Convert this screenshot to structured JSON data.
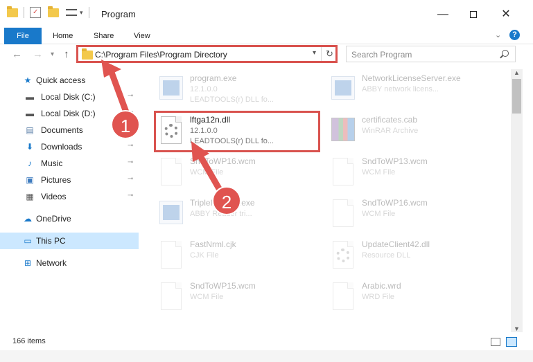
{
  "window": {
    "title": "Program",
    "min_glyph": "—",
    "close_glyph": "✕"
  },
  "ribbon": {
    "file": "File",
    "home": "Home",
    "share": "Share",
    "view": "View"
  },
  "nav": {
    "back": "←",
    "forward": "→",
    "recent": "▾",
    "up": "↑",
    "address": "C:\\Program Files\\Program Directory",
    "address_drop": "▾",
    "refresh": "↻",
    "search_placeholder": "Search Program"
  },
  "sidebar": {
    "items": [
      {
        "label": "Quick access",
        "icon": "star-icon",
        "glyph": "★",
        "color": "#1979ca",
        "pinned": false
      },
      {
        "label": "Local Disk (C:)",
        "icon": "drive-icon",
        "glyph": "▬",
        "color": "#555555",
        "pinned": true
      },
      {
        "label": "Local Disk (D:)",
        "icon": "drive-icon",
        "glyph": "▬",
        "color": "#555555",
        "pinned": true
      },
      {
        "label": "Documents",
        "icon": "documents-icon",
        "glyph": "▤",
        "color": "#5b7fa8",
        "pinned": true
      },
      {
        "label": "Downloads",
        "icon": "download-icon",
        "glyph": "⬇",
        "color": "#1979ca",
        "pinned": true
      },
      {
        "label": "Music",
        "icon": "music-icon",
        "glyph": "♪",
        "color": "#1979ca",
        "pinned": true
      },
      {
        "label": "Pictures",
        "icon": "pictures-icon",
        "glyph": "▣",
        "color": "#3e7bbf",
        "pinned": true
      },
      {
        "label": "Videos",
        "icon": "videos-icon",
        "glyph": "▦",
        "color": "#555555",
        "pinned": true
      },
      {
        "label": "OneDrive",
        "icon": "cloud-icon",
        "glyph": "☁",
        "color": "#1979ca",
        "pinned": false
      },
      {
        "label": "This PC",
        "icon": "monitor-icon",
        "glyph": "▭",
        "color": "#1979ca",
        "pinned": false,
        "selected": true
      },
      {
        "label": "Network",
        "icon": "network-icon",
        "glyph": "⊞",
        "color": "#1979ca",
        "pinned": false
      }
    ],
    "pin_glyph": "📌"
  },
  "files": [
    {
      "name": "program.exe",
      "line1": "12.1.0.0",
      "line2": "LEADTOOLS(r) DLL fo...",
      "icon": "exe-icon",
      "faded": true
    },
    {
      "name": "NetworkLicenseServer.exe",
      "line1": "ABBY network licens...",
      "line2": "",
      "icon": "exe-icon",
      "faded": true
    },
    {
      "name": "lftga12n.dll",
      "line1": "12.1.0.0",
      "line2": "LEADTOOLS(r) DLL fo...",
      "icon": "gear-icon",
      "faded": false
    },
    {
      "name": "certificates.cab",
      "line1": "WinRAR Archive",
      "line2": "",
      "icon": "archive-icon",
      "faded": true
    },
    {
      "name": "SndToWP16.wcm",
      "line1": "WCM File",
      "line2": "",
      "icon": "document-icon",
      "faded": true
    },
    {
      "name": "SndToWP13.wcm",
      "line1": "WCM File",
      "line2": "",
      "icon": "document-icon",
      "faded": true
    },
    {
      "name": "TripleInstaller.exe",
      "line1": "ABBY Reader tri...",
      "line2": "",
      "icon": "exe-icon",
      "faded": true
    },
    {
      "name": "SndToWP16.wcm",
      "line1": "WCM File",
      "line2": "",
      "icon": "document-icon",
      "faded": true
    },
    {
      "name": "FastNrml.cjk",
      "line1": "CJK File",
      "line2": "",
      "icon": "document-icon",
      "faded": true
    },
    {
      "name": "UpdateClient42.dll",
      "line1": "Resource DLL",
      "line2": "",
      "icon": "gear-icon",
      "faded": true
    },
    {
      "name": "SndToWP15.wcm",
      "line1": "WCM File",
      "line2": "",
      "icon": "document-icon",
      "faded": true
    },
    {
      "name": "Arabic.wrd",
      "line1": "WRD File",
      "line2": "",
      "icon": "document-icon",
      "faded": true
    }
  ],
  "annotations": {
    "step1": "1",
    "step2": "2",
    "color": "#e05450"
  },
  "status": {
    "count": "166 items"
  }
}
